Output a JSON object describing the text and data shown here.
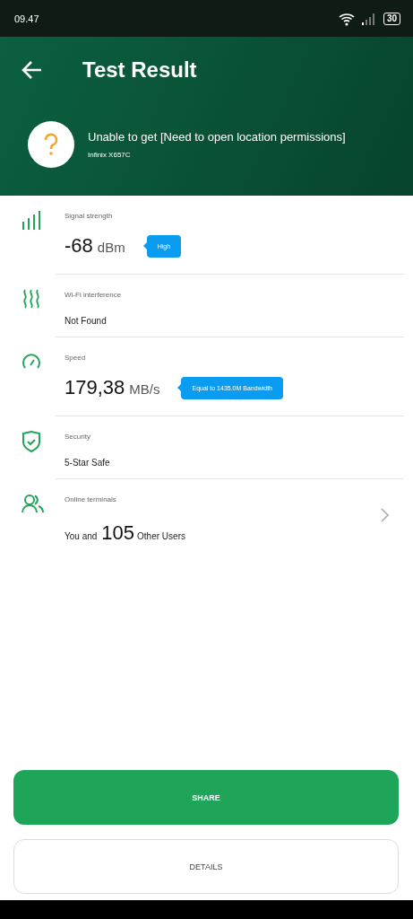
{
  "status_bar": {
    "time": "09.47",
    "battery": "30"
  },
  "header": {
    "title": "Test Result",
    "location": "Unable to get [Need to open location permissions]",
    "device": "Infinix X657C"
  },
  "items": [
    {
      "kind": "reading",
      "label": "Signal strength",
      "value": "-68",
      "unit": "dBm",
      "tag": "High"
    },
    {
      "kind": "text",
      "label": "Wi-Fi interference",
      "text": "Not Found"
    },
    {
      "kind": "reading",
      "label": "Speed",
      "value": "179,38",
      "unit": "MB/s",
      "tag": "Equal to 1435.0M Bandwidth"
    },
    {
      "kind": "text",
      "label": "Security",
      "text": "5-Star Safe"
    },
    {
      "kind": "users",
      "label": "Online terminals",
      "prefix": "You and",
      "count": "105",
      "suffix": "Other Users"
    }
  ],
  "buttons": {
    "primary": "SHARE",
    "secondary": "DETAILS"
  }
}
